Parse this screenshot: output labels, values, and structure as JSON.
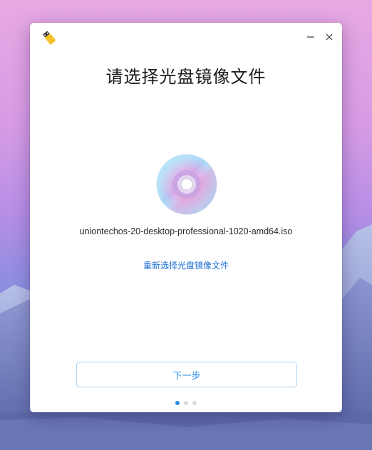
{
  "window": {
    "heading": "请选择光盘镜像文件",
    "selected_file": "uniontechos-20-desktop-professional-1020-amd64.iso",
    "reselect_link": "重新选择光盘镜像文件",
    "next_button": "下一步",
    "pager": {
      "total": 3,
      "current": 1
    }
  },
  "icons": {
    "app": "usb-drive-icon",
    "minimize": "minimize-icon",
    "close": "close-icon",
    "disc": "optical-disc-icon"
  },
  "colors": {
    "accent": "#2a8ee8",
    "link": "#1d6fd6",
    "button_border": "#a8d1f5"
  }
}
